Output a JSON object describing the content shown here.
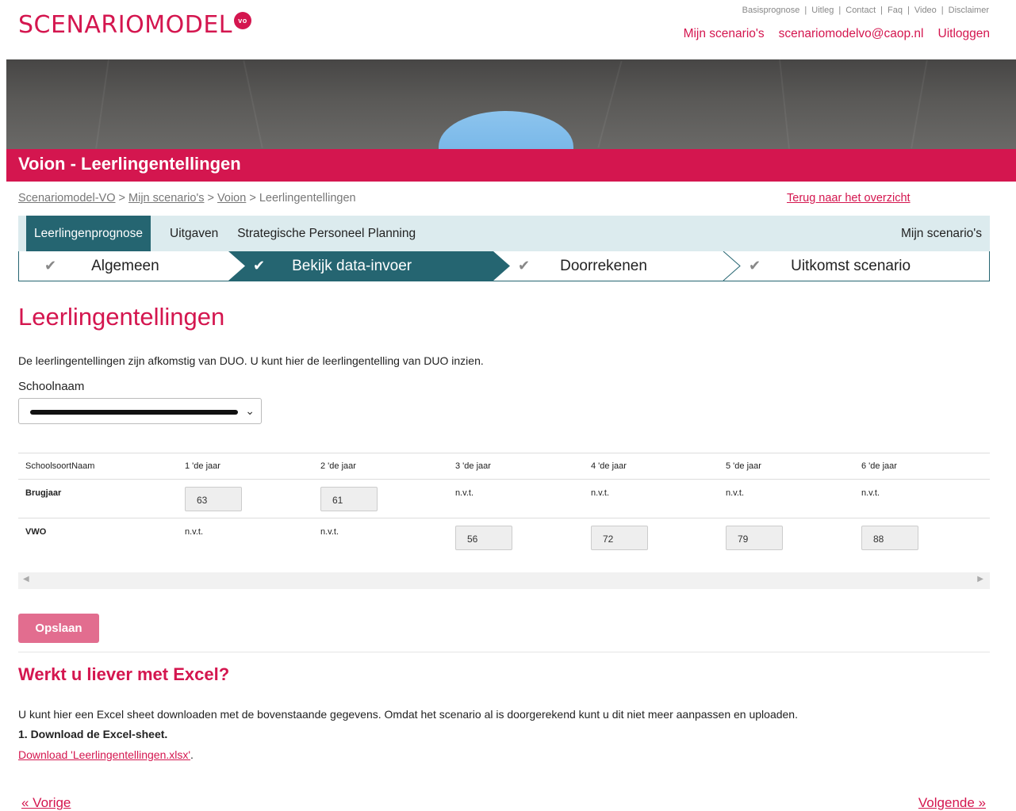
{
  "brand": {
    "name": "SCENARIOMODEL",
    "badge": "vo"
  },
  "top_links": [
    "Basisprognose",
    "Uitleg",
    "Contact",
    "Faq",
    "Video",
    "Disclaimer"
  ],
  "user_nav": {
    "scenarios": "Mijn scenario's",
    "email": "scenariomodelvo@caop.nl",
    "logout": "Uitloggen"
  },
  "page_header": {
    "title": "Voion - Leerlingentellingen"
  },
  "breadcrumb": {
    "home": "Scenariomodel-VO",
    "sep1": " > ",
    "scenarios": "Mijn scenario's",
    "sep2": " > ",
    "voion": "Voion",
    "sep3": " > ",
    "current": "Leerlingentellingen"
  },
  "back_link": "Terug naar het overzicht",
  "tabs": {
    "items": [
      "Leerlingenprognose",
      "Uitgaven",
      "Strategische Personeel Planning"
    ],
    "right": "Mijn scenario's"
  },
  "steps": [
    "Algemeen",
    "Bekijk data-invoer",
    "Doorrekenen",
    "Uitkomst scenario"
  ],
  "main": {
    "title": "Leerlingentellingen",
    "intro": "De leerlingentellingen zijn afkomstig van DUO. U kunt hier de leerlingentelling van DUO inzien.",
    "school_label": "Schoolnaam"
  },
  "table": {
    "headers": [
      "SchoolsoortNaam",
      "1 'de jaar",
      "2 'de jaar",
      "3 'de jaar",
      "4 'de jaar",
      "5 'de jaar",
      "6 'de jaar"
    ],
    "rows": [
      {
        "name": "Brugjaar",
        "values": [
          "63",
          "61",
          "n.v.t.",
          "n.v.t.",
          "n.v.t.",
          "n.v.t."
        ]
      },
      {
        "name": "VWO",
        "values": [
          "n.v.t.",
          "n.v.t.",
          "56",
          "72",
          "79",
          "88"
        ]
      }
    ]
  },
  "save_label": "Opslaan",
  "excel": {
    "title": "Werkt u liever met Excel?",
    "text": "U kunt hier een Excel sheet downloaden met de bovenstaande gegevens. Omdat het scenario al is doorgerekend kunt u dit niet meer aanpassen en uploaden.",
    "step1": "1. Download de Excel-sheet.",
    "download": "Download 'Leerlingentellingen.xlsx'",
    "download_suffix": "."
  },
  "pager": {
    "prev": "« Vorige",
    "next": "Volgende »"
  },
  "colors": {
    "brand": "#d4164f",
    "teal": "#256571",
    "tab_bg": "#dcebee",
    "save_button": "#e26d8f"
  }
}
